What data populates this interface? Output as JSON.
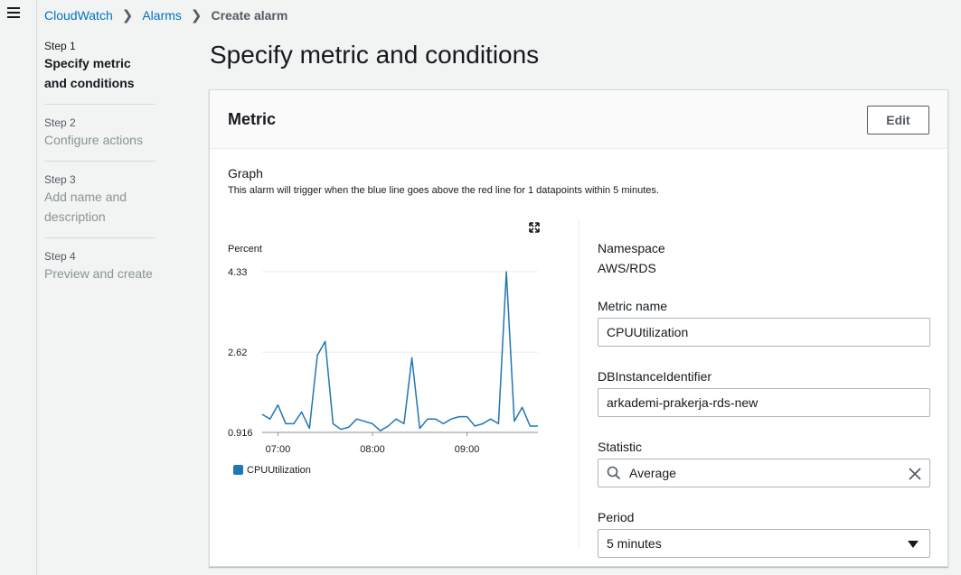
{
  "breadcrumb": {
    "items": [
      "CloudWatch",
      "Alarms"
    ],
    "current": "Create alarm"
  },
  "steps": [
    {
      "num": "Step 1",
      "title": "Specify metric and conditions",
      "active": true
    },
    {
      "num": "Step 2",
      "title": "Configure actions",
      "active": false
    },
    {
      "num": "Step 3",
      "title": "Add name and description",
      "active": false
    },
    {
      "num": "Step 4",
      "title": "Preview and create",
      "active": false
    }
  ],
  "page": {
    "title": "Specify metric and conditions"
  },
  "metric_panel": {
    "title": "Metric",
    "edit_label": "Edit",
    "graph_title": "Graph",
    "graph_desc": "This alarm will trigger when the blue line goes above the red line for 1 datapoints within 5 minutes."
  },
  "fields": {
    "namespace_label": "Namespace",
    "namespace_value": "AWS/RDS",
    "metric_name_label": "Metric name",
    "metric_name_value": "CPUUtilization",
    "db_label": "DBInstanceIdentifier",
    "db_value": "arkademi-prakerja-rds-new",
    "statistic_label": "Statistic",
    "statistic_value": "Average",
    "period_label": "Period",
    "period_value": "5 minutes"
  },
  "colors": {
    "series": "#1f77b4",
    "link": "#0073bb"
  },
  "icons": [
    "menu-icon",
    "chevron-right-icon",
    "expand-icon",
    "search-icon",
    "clear-icon",
    "caret-down-icon"
  ],
  "chart_data": {
    "type": "line",
    "ylabel": "Percent",
    "yticks": [
      "4.33",
      "2.62",
      "0.916"
    ],
    "ylim": [
      0.916,
      4.33
    ],
    "xticks": [
      "07:00",
      "08:00",
      "09:00"
    ],
    "xtick_values": [
      0,
      60,
      120
    ],
    "x": [
      -10,
      -5,
      0,
      5,
      10,
      15,
      20,
      25,
      30,
      35,
      40,
      45,
      50,
      55,
      60,
      65,
      70,
      75,
      80,
      85,
      90,
      95,
      100,
      105,
      110,
      115,
      120,
      125,
      130,
      135,
      140,
      145,
      150,
      155,
      160,
      165
    ],
    "series": [
      {
        "name": "CPUUtilization",
        "values": [
          1.3,
          1.2,
          1.5,
          1.1,
          1.1,
          1.35,
          1.0,
          2.55,
          2.85,
          1.1,
          0.98,
          1.03,
          1.2,
          1.15,
          1.1,
          0.95,
          1.05,
          1.2,
          1.1,
          2.5,
          1.0,
          1.2,
          1.2,
          1.1,
          1.2,
          1.25,
          1.25,
          1.05,
          1.1,
          1.2,
          1.1,
          4.33,
          1.15,
          1.45,
          1.05,
          1.05
        ]
      }
    ],
    "grid": true,
    "legend": "bottom-left"
  }
}
